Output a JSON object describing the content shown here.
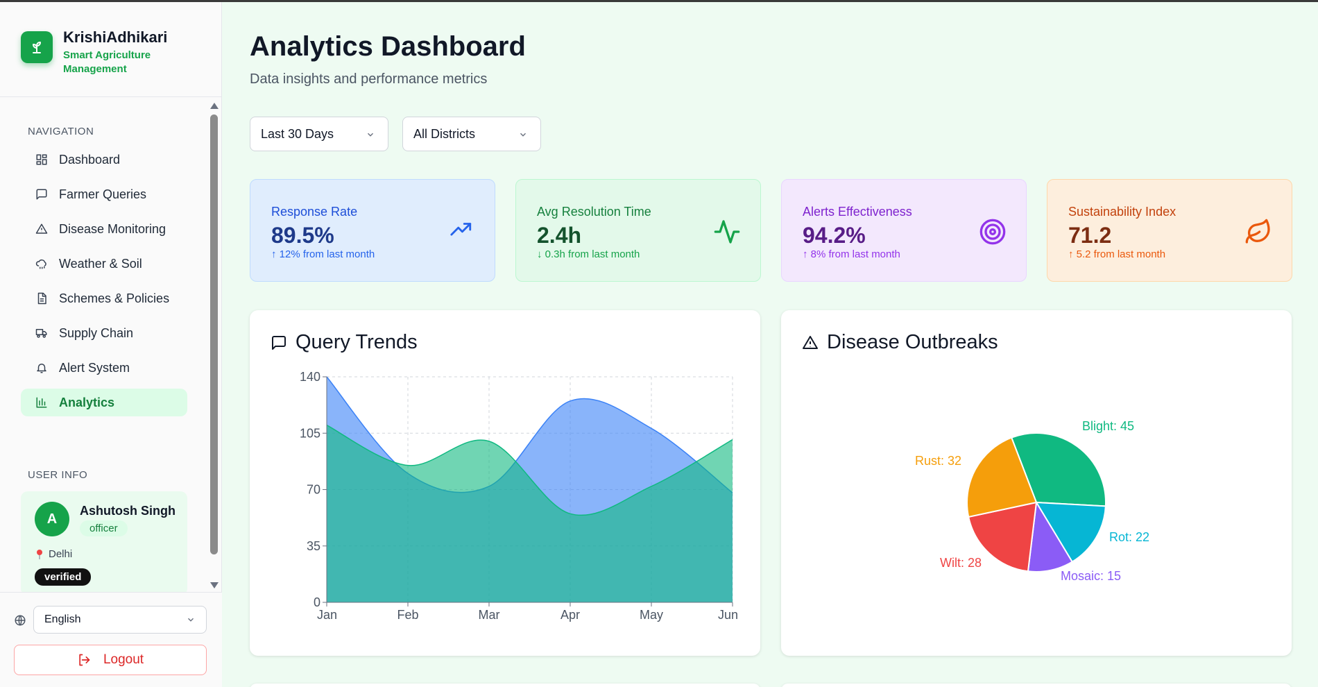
{
  "brand": {
    "name": "KrishiAdhikari",
    "tagline": "Smart Agriculture Management"
  },
  "sidebar": {
    "nav_label": "NAVIGATION",
    "items": [
      {
        "label": "Dashboard",
        "icon": "grid-icon"
      },
      {
        "label": "Farmer Queries",
        "icon": "message-icon"
      },
      {
        "label": "Disease Monitoring",
        "icon": "warning-icon"
      },
      {
        "label": "Weather & Soil",
        "icon": "cloud-icon"
      },
      {
        "label": "Schemes & Policies",
        "icon": "document-icon"
      },
      {
        "label": "Supply Chain",
        "icon": "truck-icon"
      },
      {
        "label": "Alert System",
        "icon": "bell-icon"
      },
      {
        "label": "Analytics",
        "icon": "bar-chart-icon",
        "active": true
      }
    ],
    "user_label": "USER INFO",
    "user": {
      "initial": "A",
      "name": "Ashutosh Singh",
      "role": "officer",
      "location": "Delhi",
      "status": "verified"
    },
    "language": "English",
    "logout": "Logout"
  },
  "main": {
    "title": "Analytics Dashboard",
    "subtitle": "Data insights and performance metrics",
    "filters": {
      "period": "Last 30 Days",
      "district": "All Districts"
    },
    "stats": [
      {
        "title": "Response Rate",
        "value": "89.5%",
        "change": "↑ 12% from last month",
        "icon": "trending-up-icon",
        "color": "#2563eb"
      },
      {
        "title": "Avg Resolution Time",
        "value": "2.4h",
        "change": "↓ 0.3h from last month",
        "icon": "activity-icon",
        "color": "#16a34a"
      },
      {
        "title": "Alerts Effectiveness",
        "value": "94.2%",
        "change": "↑ 8% from last month",
        "icon": "target-icon",
        "color": "#9333ea"
      },
      {
        "title": "Sustainability Index",
        "value": "71.2",
        "change": "↑ 5.2 from last month",
        "icon": "leaf-icon",
        "color": "#ea580c"
      }
    ],
    "query_trends_title": "Query Trends",
    "disease_title": "Disease Outbreaks"
  },
  "chart_data": [
    {
      "type": "area",
      "title": "Query Trends",
      "categories": [
        "Jan",
        "Feb",
        "Mar",
        "Apr",
        "May",
        "Jun"
      ],
      "ylim": [
        0,
        140
      ],
      "yticks": [
        0,
        35,
        70,
        105,
        140
      ],
      "grid": true,
      "series": [
        {
          "values": [
            140,
            80,
            72,
            125,
            108,
            68
          ],
          "color": "#3b82f6"
        },
        {
          "values": [
            110,
            85,
            100,
            55,
            72,
            101
          ],
          "color": "#10b981"
        }
      ]
    },
    {
      "type": "pie",
      "title": "Disease Outbreaks",
      "slices": [
        {
          "label": "Blight",
          "value": 45,
          "color": "#10b981"
        },
        {
          "label": "Rot",
          "value": 22,
          "color": "#06b6d4"
        },
        {
          "label": "Mosaic",
          "value": 15,
          "color": "#8b5cf6"
        },
        {
          "label": "Wilt",
          "value": 28,
          "color": "#ef4444"
        },
        {
          "label": "Rust",
          "value": 32,
          "color": "#f59e0b"
        }
      ]
    }
  ]
}
